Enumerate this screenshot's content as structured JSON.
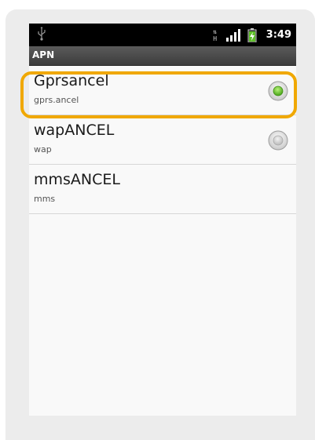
{
  "status_bar": {
    "time": "3:49",
    "network_type_text": "H",
    "icons": [
      "usb-icon",
      "h-plus-network-icon",
      "signal-strength-icon",
      "battery-charging-icon"
    ]
  },
  "title_bar": {
    "title": "APN"
  },
  "apn_list": [
    {
      "name": "Gprsancel",
      "apn": "gprs.ancel",
      "selected": true
    },
    {
      "name": "wapANCEL",
      "apn": "wap",
      "selected": false
    },
    {
      "name": "mmsANCEL",
      "apn": "mms",
      "selected": false,
      "has_radio": false
    }
  ],
  "colors": {
    "highlight": "#f0a800",
    "selected_radio": "#6cc934",
    "status_bar_bg": "#000000",
    "title_bar_bg": "#4a4a4a"
  }
}
